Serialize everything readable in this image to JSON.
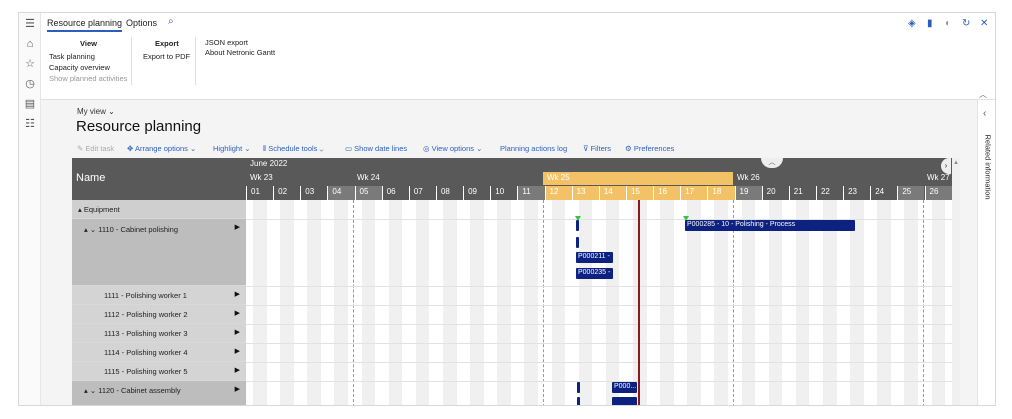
{
  "tabs": [
    "Resource planning",
    "Options"
  ],
  "ribbon": {
    "view_title": "View",
    "view_items": [
      "Task planning",
      "Capacity overview",
      "Show planned activities"
    ],
    "export_title": "Export",
    "export_items": [
      "Export to PDF"
    ],
    "json_items": [
      "JSON export",
      "About Netronic Gantt"
    ]
  },
  "page": {
    "my_view": "My view",
    "title": "Resource planning"
  },
  "toolbar": [
    "Edit task",
    "Arrange options",
    "Highlight",
    "Schedule tools",
    "Show date lines",
    "View options",
    "Planning actions log",
    "Filters",
    "Preferences"
  ],
  "gantt": {
    "name_header": "Name",
    "month": "June 2022",
    "weeks": [
      "Wk 23",
      "Wk 24",
      "Wk 25",
      "Wk 26",
      "Wk 27"
    ],
    "days": [
      "01",
      "02",
      "03",
      "04",
      "05",
      "06",
      "07",
      "08",
      "09",
      "10",
      "11",
      "12",
      "13",
      "14",
      "15",
      "16",
      "17",
      "18",
      "19",
      "20",
      "21",
      "22",
      "23",
      "24",
      "25",
      "26"
    ],
    "rows": [
      {
        "label": "Equipment"
      },
      {
        "label": "1110 - Cabinet polishing"
      },
      {
        "label": "1111 - Polishing worker 1"
      },
      {
        "label": "1112 - Polishing worker 2"
      },
      {
        "label": "1113 - Polishing worker 3"
      },
      {
        "label": "1114 - Polishing worker 4"
      },
      {
        "label": "1115 - Polishing worker 5"
      },
      {
        "label": "1120 - Cabinet assembly"
      }
    ],
    "bars": [
      "P000285 - 10 - Polishing - Process",
      "P000211 -",
      "P000235 -",
      "P000..."
    ]
  },
  "right_pane": {
    "label": "Related information"
  }
}
